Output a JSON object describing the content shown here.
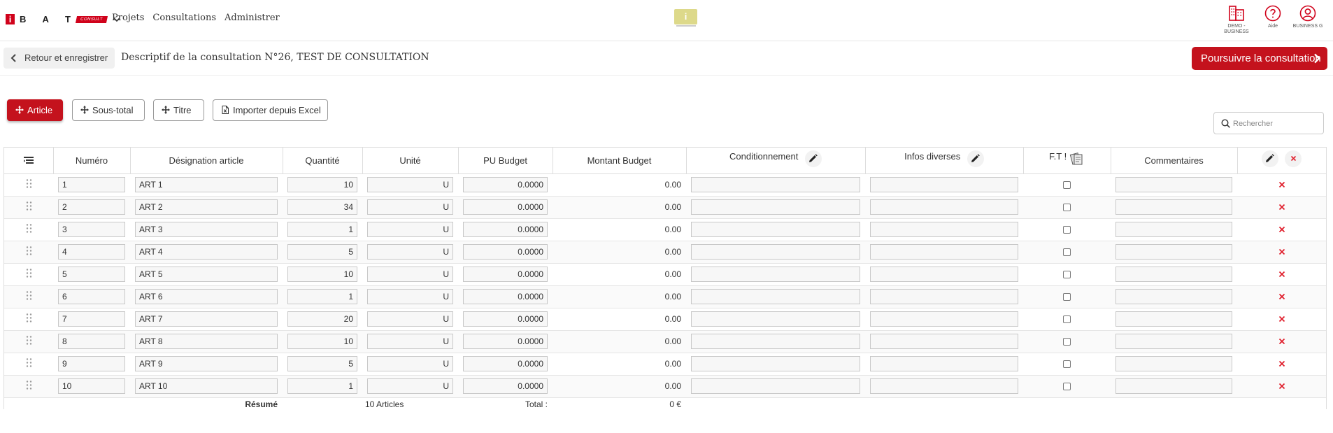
{
  "header": {
    "logo_letter": "i",
    "logo_text": "B A T",
    "logo_tag": "CONSULT",
    "nav": [
      "Projets",
      "Consultations",
      "Administrer"
    ],
    "center_badge": "i",
    "right": [
      {
        "icon": "building-icon",
        "label": "DEMO - BUSINESS"
      },
      {
        "icon": "help-icon",
        "label": "Aide"
      },
      {
        "icon": "user-icon",
        "label": "BUSINESS G"
      }
    ]
  },
  "titlebar": {
    "back_label": "Retour et enregistrer",
    "title": "Descriptif de la consultation N°26, TEST DE CONSULTATION",
    "continue_label": "Poursuivre la consultation"
  },
  "toolbar": {
    "article": "Article",
    "subtotal": "Sous-total",
    "titre": "Titre",
    "import": "Importer depuis Excel",
    "search_placeholder": "Rechercher"
  },
  "table": {
    "columns": {
      "numero": "Numéro",
      "designation": "Désignation article",
      "quantite": "Quantité",
      "unite": "Unité",
      "pu": "PU Budget",
      "montant": "Montant Budget",
      "conditionnement": "Conditionnement",
      "infos": "Infos diverses",
      "ft": "F.T !",
      "commentaires": "Commentaires"
    },
    "rows": [
      {
        "num": "1",
        "designation": "ART 1",
        "qty": "10",
        "unit": "U",
        "pu": "0.0000",
        "montant": "0.00"
      },
      {
        "num": "2",
        "designation": "ART 2",
        "qty": "34",
        "unit": "U",
        "pu": "0.0000",
        "montant": "0.00"
      },
      {
        "num": "3",
        "designation": "ART 3",
        "qty": "1",
        "unit": "U",
        "pu": "0.0000",
        "montant": "0.00"
      },
      {
        "num": "4",
        "designation": "ART 4",
        "qty": "5",
        "unit": "U",
        "pu": "0.0000",
        "montant": "0.00"
      },
      {
        "num": "5",
        "designation": "ART 5",
        "qty": "10",
        "unit": "U",
        "pu": "0.0000",
        "montant": "0.00"
      },
      {
        "num": "6",
        "designation": "ART 6",
        "qty": "1",
        "unit": "U",
        "pu": "0.0000",
        "montant": "0.00"
      },
      {
        "num": "7",
        "designation": "ART 7",
        "qty": "20",
        "unit": "U",
        "pu": "0.0000",
        "montant": "0.00"
      },
      {
        "num": "8",
        "designation": "ART 8",
        "qty": "10",
        "unit": "U",
        "pu": "0.0000",
        "montant": "0.00"
      },
      {
        "num": "9",
        "designation": "ART 9",
        "qty": "5",
        "unit": "U",
        "pu": "0.0000",
        "montant": "0.00"
      },
      {
        "num": "10",
        "designation": "ART 10",
        "qty": "1",
        "unit": "U",
        "pu": "0.0000",
        "montant": "0.00"
      }
    ],
    "summary": {
      "label": "Résumé",
      "count": "10 Articles",
      "total_label": "Total :",
      "total_value": "0 €"
    }
  },
  "colors": {
    "brand_red": "#c4121d",
    "delete_red": "#e0202d"
  }
}
